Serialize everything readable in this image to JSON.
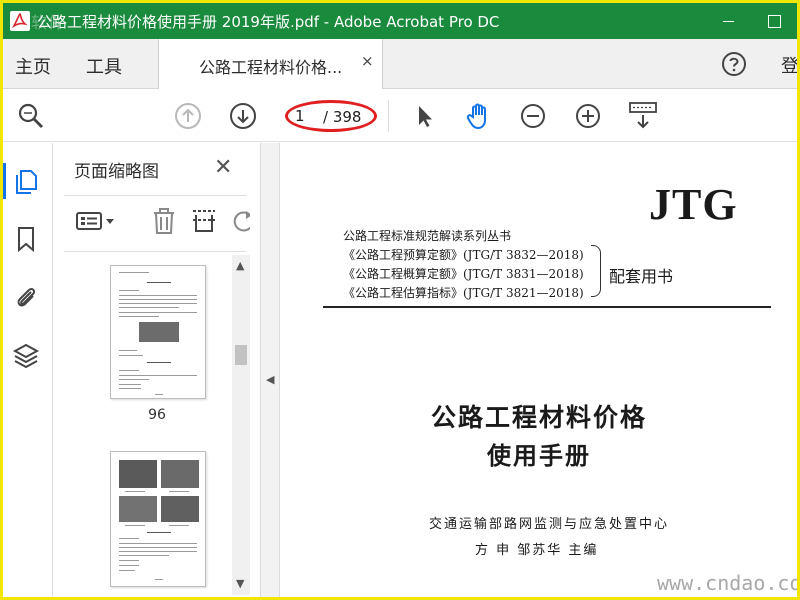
{
  "window": {
    "title": "公路工程材料价格使用手册 2019年版.pdf - Adobe Acrobat Pro DC",
    "watermark_text": "软件",
    "minimize_label": "minimize",
    "maximize_label": "maximize"
  },
  "tabs": {
    "home": "主页",
    "tools": "工具",
    "doc_tab": "公路工程材料价格...",
    "close_glyph": "×",
    "login": "登"
  },
  "toolbar": {
    "current_page": "1",
    "page_total": "/ 398",
    "icons": [
      "search-zoom-icon",
      "prev-page-icon",
      "next-page-icon",
      "select-pointer-icon",
      "hand-tool-icon",
      "zoom-out-icon",
      "zoom-in-icon",
      "keyboard-scroll-icon"
    ]
  },
  "sidebar": {
    "panel_title": "页面缩略图",
    "close_glyph": "✕",
    "rail_icons": [
      "page-thumbnails-icon",
      "bookmarks-icon",
      "attachments-icon",
      "layers-icon"
    ],
    "thumbnails": [
      {
        "page_label": "96"
      },
      {
        "page_label": ""
      }
    ]
  },
  "document": {
    "jtg": "JTG",
    "series": "公路工程标准规范解读系列丛书",
    "standards": [
      "《公路工程预算定额》(JTG/T 3832—2018)",
      "《公路工程概算定额》(JTG/T 3831—2018)",
      "《公路工程估算指标》(JTG/T 3821—2018)"
    ],
    "supporting": "配套用书",
    "title_line1": "公路工程材料价格",
    "title_line2": "使用手册",
    "publisher": "交通运输部路网监测与应急处置中心",
    "authors": "方  申  邹苏华  主编",
    "site_watermark": "www.cndao.com"
  },
  "colors": {
    "titlebar": "#1a8a3c",
    "outer_border": "#f2e600",
    "annotation_red": "#e02020",
    "accent_blue": "#1473e6"
  }
}
